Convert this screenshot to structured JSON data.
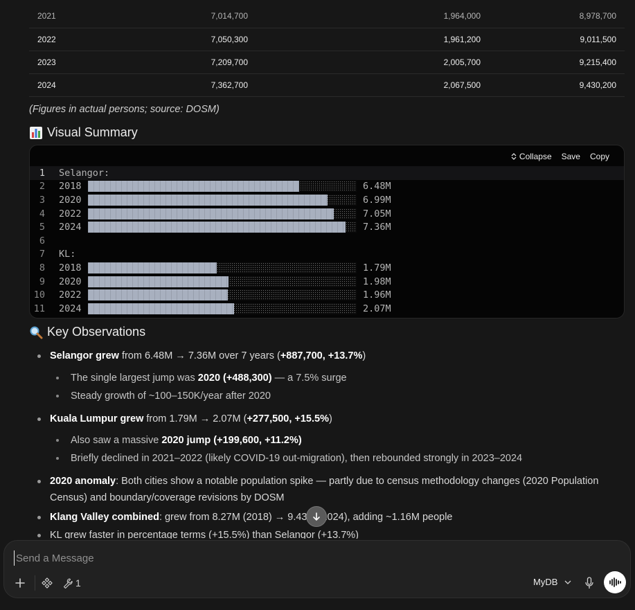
{
  "table": {
    "rows": [
      [
        "2021",
        "7,014,700",
        "1,964,000",
        "8,978,700"
      ],
      [
        "2022",
        "7,050,300",
        "1,961,200",
        "9,011,500"
      ],
      [
        "2023",
        "7,209,700",
        "2,005,700",
        "9,215,400"
      ],
      [
        "2024",
        "7,362,700",
        "2,067,500",
        "9,430,200"
      ]
    ]
  },
  "note": "(Figures in actual persons; source: DOSM)",
  "visual_summary": {
    "heading": "Visual Summary",
    "icon": "bar-chart-emoji",
    "toolbar": {
      "collapse": "Collapse",
      "save": "Save",
      "copy": "Copy"
    },
    "lines": [
      {
        "n": "1",
        "text": "Selangor:"
      },
      {
        "n": "2",
        "label": "2018",
        "value": "6.48M",
        "fill": 0.785
      },
      {
        "n": "3",
        "label": "2020",
        "value": "6.99M",
        "fill": 0.893
      },
      {
        "n": "4",
        "label": "2022",
        "value": "7.05M",
        "fill": 0.915
      },
      {
        "n": "5",
        "label": "2024",
        "value": "7.36M",
        "fill": 0.958
      },
      {
        "n": "6",
        "text": ""
      },
      {
        "n": "7",
        "text": "KL:"
      },
      {
        "n": "8",
        "label": "2018",
        "value": "1.79M",
        "fill": 0.48
      },
      {
        "n": "9",
        "label": "2020",
        "value": "1.98M",
        "fill": 0.523
      },
      {
        "n": "10",
        "label": "2022",
        "value": "1.96M",
        "fill": 0.52
      },
      {
        "n": "11",
        "label": "2024",
        "value": "2.07M",
        "fill": 0.545
      }
    ]
  },
  "key_observations": {
    "heading": "Key Observations",
    "icon": "magnifier-emoji",
    "items": [
      {
        "parts": [
          [
            "b",
            "Selangor grew"
          ],
          [
            "t",
            " from 6.48M → 7.36M over 7 years ("
          ],
          [
            "b",
            "+887,700, +13.7%"
          ],
          [
            "t",
            ")"
          ]
        ]
      },
      {
        "sub": true,
        "parts": [
          [
            "t",
            "The single largest jump was "
          ],
          [
            "b",
            "2020 (+488,300)"
          ],
          [
            "t",
            " — a 7.5% surge"
          ]
        ]
      },
      {
        "sub": true,
        "parts": [
          [
            "t",
            "Steady growth of ~100–150K/year after 2020"
          ]
        ]
      },
      {
        "parts": [
          [
            "b",
            "Kuala Lumpur grew"
          ],
          [
            "t",
            " from 1.79M → 2.07M ("
          ],
          [
            "b",
            "+277,500, +15.5%"
          ],
          [
            "t",
            ")"
          ]
        ]
      },
      {
        "sub": true,
        "parts": [
          [
            "t",
            "Also saw a massive "
          ],
          [
            "b",
            "2020 jump (+199,600, +11.2%)"
          ]
        ]
      },
      {
        "sub": true,
        "parts": [
          [
            "t",
            "Briefly declined in 2021–2022 (likely COVID-19 out-migration), then rebounded strongly in 2023–2024"
          ]
        ]
      },
      {
        "parts": [
          [
            "b",
            "2020 anomaly"
          ],
          [
            "t",
            ": Both cities show a notable population spike — partly due to census methodology changes (2020 Population Census) and boundary/coverage revisions by DOSM"
          ]
        ]
      },
      {
        "parts": [
          [
            "b",
            "Klang Valley combined"
          ],
          [
            "t",
            ": grew from 8.27M (2018) → 9.43M (2024), adding ~1.16M people"
          ]
        ]
      },
      {
        "parts": [
          [
            "t",
            "KL grew faster in percentage terms (+15.5%) than Selangor (+13.7%)"
          ]
        ]
      }
    ]
  },
  "composer": {
    "placeholder": "Send a Message",
    "tools_count": "1",
    "model": "MyDB"
  }
}
